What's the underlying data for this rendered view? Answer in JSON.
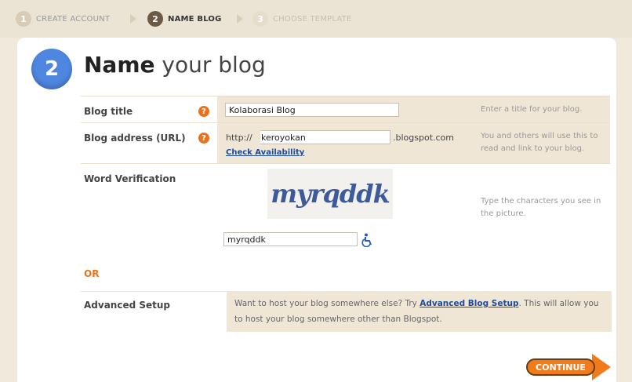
{
  "steps": [
    {
      "num": "1",
      "label": "CREATE ACCOUNT",
      "state": "done"
    },
    {
      "num": "2",
      "label": "NAME BLOG",
      "state": "active"
    },
    {
      "num": "3",
      "label": "CHOOSE TEMPLATE",
      "state": "todo"
    }
  ],
  "header": {
    "step_number": "2",
    "title_bold": "Name",
    "title_rest": "your blog"
  },
  "blog_title": {
    "label": "Blog title",
    "value": "Kolaborasi Blog",
    "hint": "Enter a title for your blog."
  },
  "blog_address": {
    "label": "Blog address (URL)",
    "prefix": "http://",
    "value": "keroyokan",
    "suffix": ".blogspot.com",
    "check_link": "Check Availability",
    "hint": "You and others will use this to read and link to your blog."
  },
  "verification": {
    "label": "Word Verification",
    "captcha_text": "myrqddk",
    "value": "myrqddk",
    "hint": "Type the characters you see in the picture."
  },
  "or_label": "OR",
  "advanced": {
    "label": "Advanced Setup",
    "text_before": "Want to host your blog somewhere else? Try",
    "link": "Advanced Blog Setup",
    "text_after": ". This will allow you to host your blog somewhere other than Blogspot."
  },
  "continue_label": "CONTINUE",
  "colors": {
    "accent": "#e8731c",
    "step_blue": "#4f86e0",
    "link": "#1f4b9a"
  },
  "icons": {
    "help": "question-icon",
    "accessibility": "wheelchair-icon"
  }
}
